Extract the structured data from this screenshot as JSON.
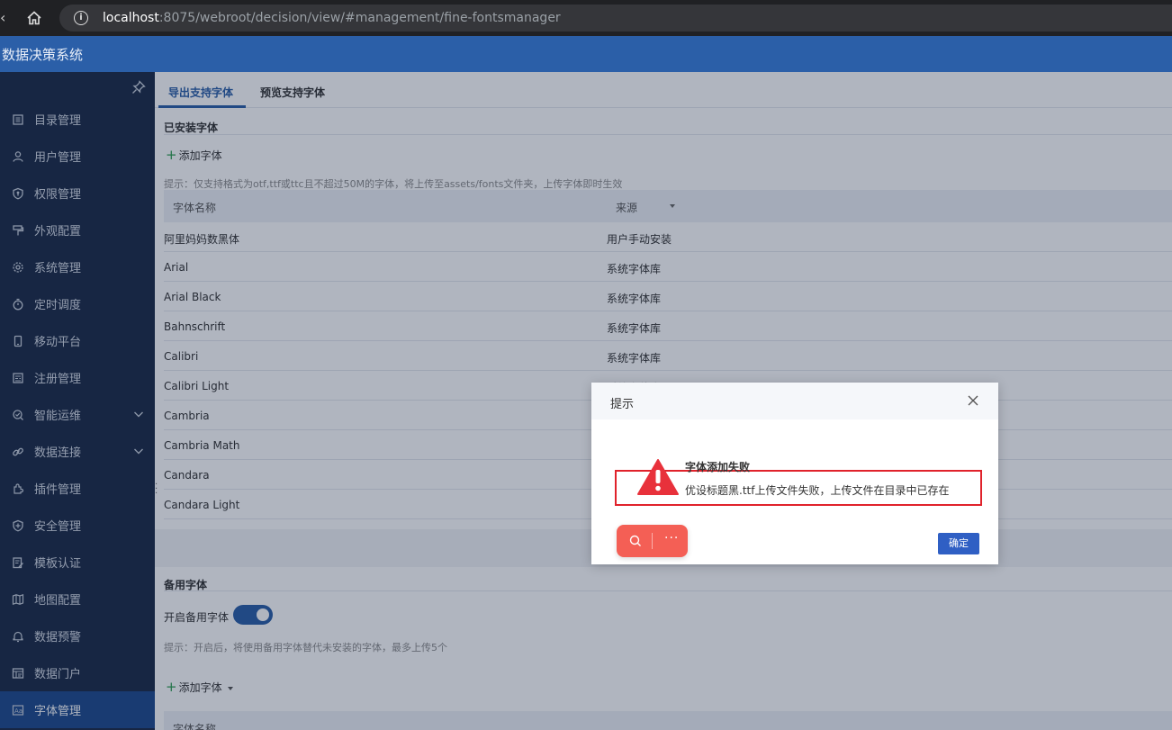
{
  "browser": {
    "url_host": "localhost",
    "url_rest": ":8075/webroot/decision/view/#management/fine-fontsmanager"
  },
  "app": {
    "title": "数据决策系统"
  },
  "sidebar": {
    "items": [
      {
        "label": "目录管理",
        "icon": "catalog-icon"
      },
      {
        "label": "用户管理",
        "icon": "user-icon"
      },
      {
        "label": "权限管理",
        "icon": "shield-key-icon"
      },
      {
        "label": "外观配置",
        "icon": "paint-roller-icon"
      },
      {
        "label": "系统管理",
        "icon": "gear-icon"
      },
      {
        "label": "定时调度",
        "icon": "timer-icon"
      },
      {
        "label": "移动平台",
        "icon": "mobile-icon"
      },
      {
        "label": "注册管理",
        "icon": "register-icon"
      },
      {
        "label": "智能运维",
        "icon": "ops-icon",
        "expandable": true
      },
      {
        "label": "数据连接",
        "icon": "link-icon",
        "expandable": true
      },
      {
        "label": "插件管理",
        "icon": "plugin-icon"
      },
      {
        "label": "安全管理",
        "icon": "security-icon"
      },
      {
        "label": "模板认证",
        "icon": "template-cert-icon"
      },
      {
        "label": "地图配置",
        "icon": "map-icon"
      },
      {
        "label": "数据预警",
        "icon": "bell-icon"
      },
      {
        "label": "数据门户",
        "icon": "portal-icon"
      },
      {
        "label": "字体管理",
        "icon": "font-icon",
        "active": true
      }
    ]
  },
  "tabs": [
    {
      "label": "导出支持字体",
      "active": true
    },
    {
      "label": "预览支持字体",
      "active": false
    }
  ],
  "installed": {
    "title": "已安装字体",
    "add_label": "添加字体",
    "hint": "提示：仅支持格式为otf,ttf或ttc且不超过50M的字体，将上传至assets/fonts文件夹，上传字体即时生效",
    "columns": [
      "字体名称",
      "来源"
    ],
    "rows": [
      [
        "阿里妈妈数黑体",
        "用户手动安装"
      ],
      [
        "Arial",
        "系统字体库"
      ],
      [
        "Arial Black",
        "系统字体库"
      ],
      [
        "Bahnschrift",
        "系统字体库"
      ],
      [
        "Calibri",
        "系统字体库"
      ],
      [
        "Calibri Light",
        "系统字体库"
      ],
      [
        "Cambria",
        ""
      ],
      [
        "Cambria Math",
        ""
      ],
      [
        "Candara",
        ""
      ],
      [
        "Candara Light",
        ""
      ]
    ]
  },
  "backup": {
    "title": "备用字体",
    "toggle_label": "开启备用字体",
    "toggle_on": true,
    "hint": "提示：开启后，将使用备用字体替代未安装的字体，最多上传5个",
    "add_label": "添加字体",
    "column": "字体名称"
  },
  "dialog": {
    "title": "提示",
    "error_title": "字体添加失败",
    "error_message": "优设标题黑.ttf上传文件失败，上传文件在目录中已存在",
    "ok_label": "确定"
  },
  "colors": {
    "header": "#2b5fa8",
    "sidebar": "#1b2b47",
    "accent": "#2b5fa8",
    "warning": "#e8313b",
    "highlight_box": "#e0222b",
    "float_bar": "#f45f55"
  }
}
